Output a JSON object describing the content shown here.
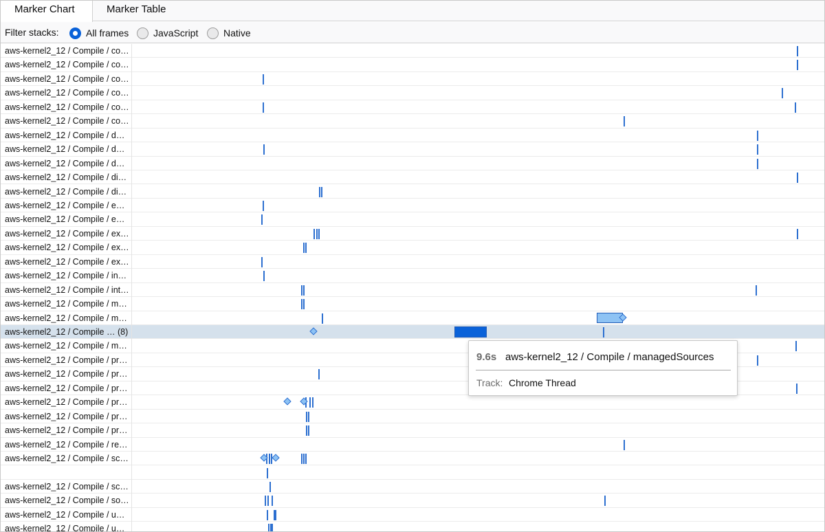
{
  "tabs": [
    {
      "label": "Marker Chart",
      "selected": true
    },
    {
      "label": "Marker Table",
      "selected": false
    }
  ],
  "filter": {
    "label": "Filter stacks:",
    "options": [
      {
        "label": "All frames",
        "checked": true
      },
      {
        "label": "JavaScript",
        "checked": false
      },
      {
        "label": "Native",
        "checked": false
      }
    ]
  },
  "rows": [
    "aws-kernel2_12 / Compile / co…",
    "aws-kernel2_12 / Compile / co…",
    "aws-kernel2_12 / Compile / co…",
    "aws-kernel2_12 / Compile / co…",
    "aws-kernel2_12 / Compile / co…",
    "aws-kernel2_12 / Compile / co…",
    "aws-kernel2_12 / Compile / d…",
    "aws-kernel2_12 / Compile / d…",
    "aws-kernel2_12 / Compile / d…",
    "aws-kernel2_12 / Compile / di…",
    "aws-kernel2_12 / Compile / di…",
    "aws-kernel2_12 / Compile / e…",
    "aws-kernel2_12 / Compile / e…",
    "aws-kernel2_12 / Compile / ex…",
    "aws-kernel2_12 / Compile / ex…",
    "aws-kernel2_12 / Compile / ex…",
    "aws-kernel2_12 / Compile / in…",
    "aws-kernel2_12 / Compile / int…",
    "aws-kernel2_12 / Compile / m…",
    "aws-kernel2_12 / Compile / m…",
    "aws-kernel2_12 / Compile … (8)",
    "aws-kernel2_12 / Compile / m…",
    "aws-kernel2_12 / Compile / pr…",
    "aws-kernel2_12 / Compile / pr…",
    "aws-kernel2_12 / Compile / pr…",
    "aws-kernel2_12 / Compile / pr…",
    "aws-kernel2_12 / Compile / pr…",
    "aws-kernel2_12 / Compile / pr…",
    "aws-kernel2_12 / Compile / re…",
    "aws-kernel2_12 / Compile / sc…",
    "",
    "aws-kernel2_12 / Compile / sc…",
    "aws-kernel2_12 / Compile / so…",
    "aws-kernel2_12 / Compile / u…",
    "aws-kernel2_12 / Compile / u…"
  ],
  "selected_row": 20,
  "tooltip": {
    "duration": "9.6s",
    "title": "aws-kernel2_12 / Compile / managedSources",
    "track_label": "Track:",
    "track_value": "Chrome Thread"
  },
  "colors": {
    "marker": "#2c6fd0",
    "marker_light": "#8ec3f4",
    "selected_marker": "#0a62d9",
    "selected_row": "#d5e1ec",
    "radio_accent": "#0a62d9"
  }
}
